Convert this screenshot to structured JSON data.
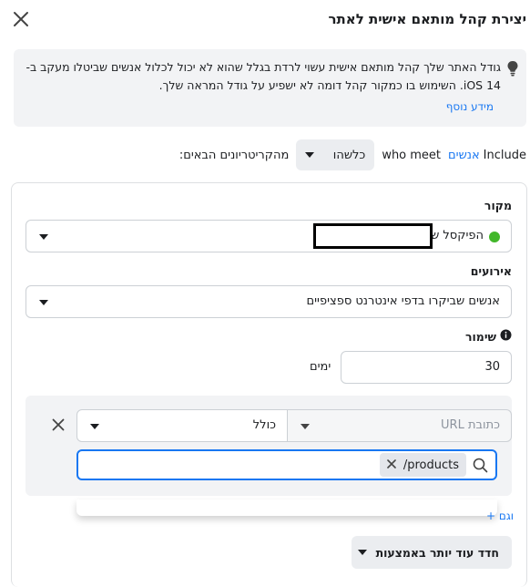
{
  "header": {
    "title": "יצירת קהל מותאם אישית לאתר",
    "close_icon": "close-icon"
  },
  "info": {
    "text": "גודל האתר שלך קהל מותאם אישית עשוי לרדת בגלל שהוא לא יכול לכלול אנשים שביטלו מעקב ב-iOS 14. השימוש בו כמקור קהל דומה לא ישפיע על גודל המראה שלך.",
    "link": "מידע נוסף",
    "icon": "lightbulb-icon"
  },
  "include_row": {
    "word_include": "Include",
    "people_link": "אנשים",
    "who_meet": "who meet",
    "match_select": "כלשהו",
    "suffix": "מהקריטריונים הבאים:"
  },
  "source": {
    "label": "מקור",
    "value": "הפיקסל של",
    "status_color": "#42b72a"
  },
  "events": {
    "label": "אירועים",
    "value": "אנשים שביקרו בדפי אינטרנט ספציפיים"
  },
  "retention": {
    "label": "שימור",
    "value": "30",
    "unit": "ימים",
    "icon": "info-icon"
  },
  "rule": {
    "field_placeholder": "כתובת URL",
    "operator": "כולל",
    "token_value": "/products",
    "search_icon": "search-icon"
  },
  "add_link": "+ וגם",
  "refine_button": "חדד עוד יותר באמצעות",
  "colors": {
    "accent": "#1877f2",
    "panel_bg": "#f2f3f5"
  }
}
